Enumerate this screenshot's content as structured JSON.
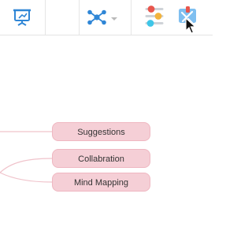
{
  "toolbar": {
    "icons": [
      "presentation-icon",
      "structure-icon",
      "chevron-down-icon",
      "style-panel-icon",
      "format-icon"
    ],
    "colors": {
      "accent_blue": "#2f86d6",
      "style_red": "#e8564d",
      "style_orange": "#f2b33d",
      "style_cyan": "#3fc6e8"
    }
  },
  "mindmap": {
    "nodes": [
      {
        "label": "Suggestions"
      },
      {
        "label": "Collabration"
      },
      {
        "label": "Mind Mapping"
      }
    ],
    "colors": {
      "node_fill": "#f5cfd6",
      "node_border": "#efb7c1",
      "connector": "#f0c3cb"
    }
  }
}
